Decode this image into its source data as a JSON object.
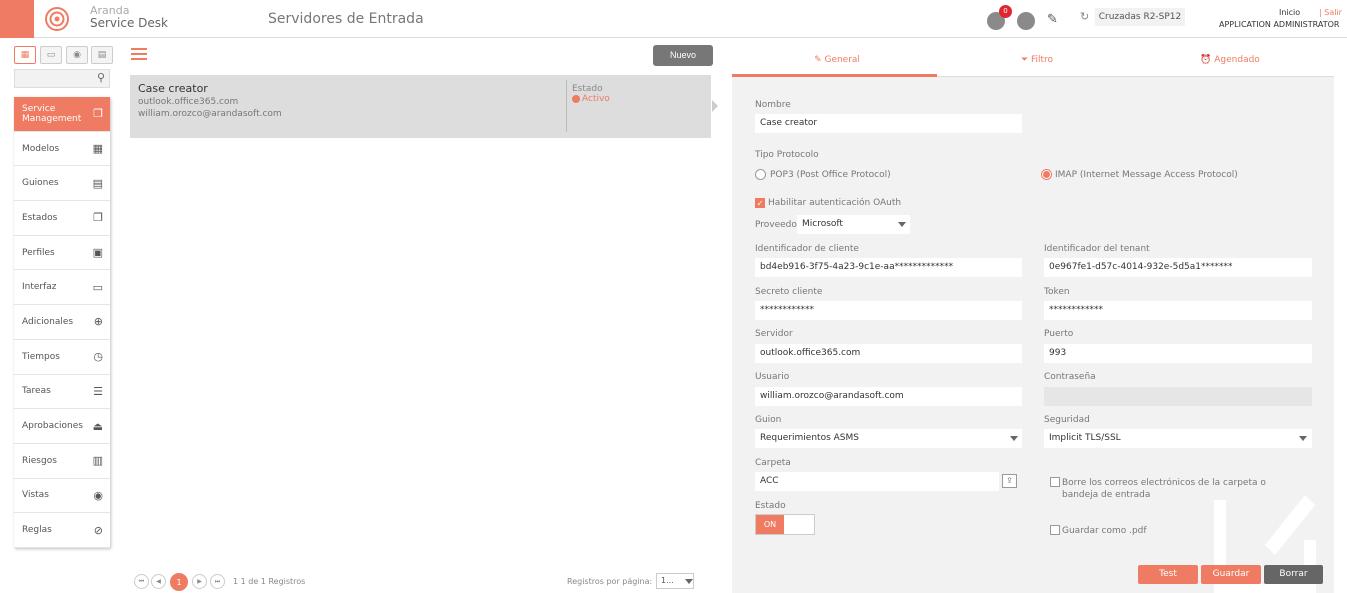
{
  "header": {
    "brand_top": "Aranda",
    "brand_bottom": "Service Desk",
    "page_title": "Servidores de Entrada",
    "notif_count": "0",
    "environment": "Cruzadas R2-SP12",
    "inicio": "Inicio",
    "salir": "| Salir",
    "user_role": "APPLICATION ADMINISTRATOR"
  },
  "sidebar": {
    "items": [
      {
        "label": "Service Management",
        "icon": "layers-icon"
      },
      {
        "label": "Modelos",
        "icon": "grid-icon"
      },
      {
        "label": "Guiones",
        "icon": "document-icon"
      },
      {
        "label": "Estados",
        "icon": "copy-icon"
      },
      {
        "label": "Perfiles",
        "icon": "profile-icon"
      },
      {
        "label": "Interfaz",
        "icon": "monitor-icon"
      },
      {
        "label": "Adicionales",
        "icon": "plus-circle-icon"
      },
      {
        "label": "Tiempos",
        "icon": "stopwatch-icon"
      },
      {
        "label": "Tareas",
        "icon": "tasks-icon"
      },
      {
        "label": "Aprobaciones",
        "icon": "stamp-icon"
      },
      {
        "label": "Riesgos",
        "icon": "barrier-icon"
      },
      {
        "label": "Vistas",
        "icon": "eye-icon"
      },
      {
        "label": "Reglas",
        "icon": "compass-icon"
      }
    ]
  },
  "list": {
    "nuevo_label": "Nuevo",
    "card": {
      "title": "Case creator",
      "server": "outlook.office365.com",
      "user": "william.orozco@arandasoft.com",
      "estado_label": "Estado",
      "estado_value": "Activo"
    },
    "pagination": {
      "current": "1",
      "summary": "1 1 de 1 Registros",
      "per_page_label": "Registros por página:",
      "per_page_value": "1..."
    }
  },
  "form": {
    "tabs": {
      "general": "General",
      "filtro": "Filtro",
      "agendado": "Agendado"
    },
    "nombre_label": "Nombre",
    "nombre_value": "Case creator",
    "protocolo_label": "Tipo Protocolo",
    "pop3_label": "POP3 (Post Office Protocol)",
    "imap_label": "IMAP (Internet Message Access Protocol)",
    "oauth_label": "Habilitar autenticación OAuth",
    "proveedor_label": "Proveedor",
    "proveedor_value": "Microsoft",
    "cliente_label": "Identificador de cliente",
    "cliente_value": "bd4eb916-3f75-4a23-9c1e-aa*************",
    "tenant_label": "Identificador del tenant",
    "tenant_value": "0e967fe1-d57c-4014-932e-5d5a1*******",
    "secreto_label": "Secreto cliente",
    "secreto_value": "************",
    "token_label": "Token",
    "token_value": "************",
    "servidor_label": "Servidor",
    "servidor_value": "outlook.office365.com",
    "puerto_label": "Puerto",
    "puerto_value": "993",
    "usuario_label": "Usuario",
    "usuario_value": "william.orozco@arandasoft.com",
    "password_label": "Contraseña",
    "guion_label": "Guion",
    "guion_value": "Requerimientos ASMS",
    "seguridad_label": "Seguridad",
    "seguridad_value": "Implicit TLS/SSL",
    "carpeta_label": "Carpeta",
    "carpeta_value": "ACC",
    "borrar_correos_label": "Borre los correos electrónicos de la carpeta o bandeja de entrada",
    "estado_label": "Estado",
    "estado_toggle": "ON",
    "pdf_label": "Guardar como .pdf",
    "test_label": "Test",
    "guardar_label": "Guardar",
    "borrar_label": "Borrar"
  },
  "colors": {
    "accent": "#f07b63",
    "dark_button": "#666666"
  }
}
